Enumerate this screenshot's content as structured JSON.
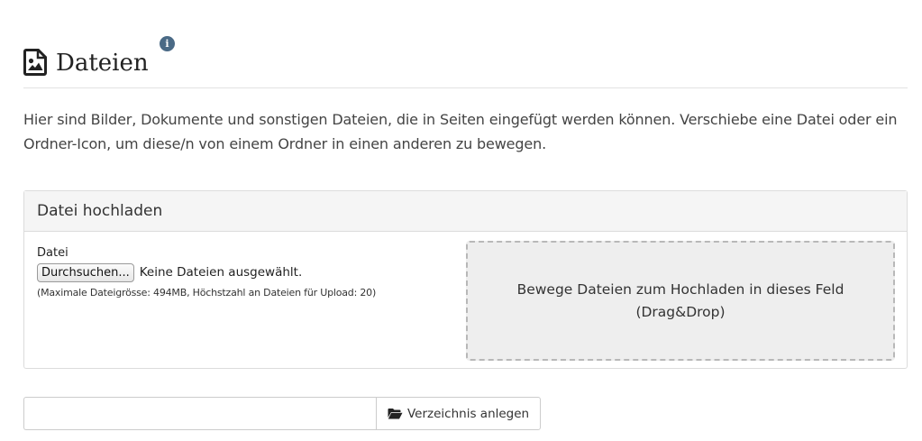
{
  "header": {
    "title": "Dateien",
    "info_badge": "i"
  },
  "intro_text": "Hier sind Bilder, Dokumente und sonstigen Dateien, die in Seiten eingefügt werden können. Verschiebe eine Datei oder ein Ordner-Icon, um diese/n von einem Ordner in einen anderen zu bewegen.",
  "upload_panel": {
    "heading": "Datei hochladen",
    "field_label": "Datei",
    "browse_label": "Durchsuchen...",
    "no_file_text": "Keine Dateien ausgewählt.",
    "hint": "(Maximale Dateigrösse: 494MB, Höchstzahl an Dateien für Upload: 20)",
    "dropzone_text": "Bewege Dateien zum Hochladen in dieses Feld (Drag&Drop)"
  },
  "directory": {
    "input_value": "",
    "input_placeholder": "",
    "button_label": "Verzeichnis anlegen"
  },
  "icons": {
    "title_icon": "image-file-icon",
    "info_icon": "info-icon",
    "folder_icon": "folder-open-icon"
  },
  "colors": {
    "info_badge": "#4a6a86",
    "dropzone_bg": "#eeeeee",
    "panel_heading_bg": "#f5f5f5"
  }
}
